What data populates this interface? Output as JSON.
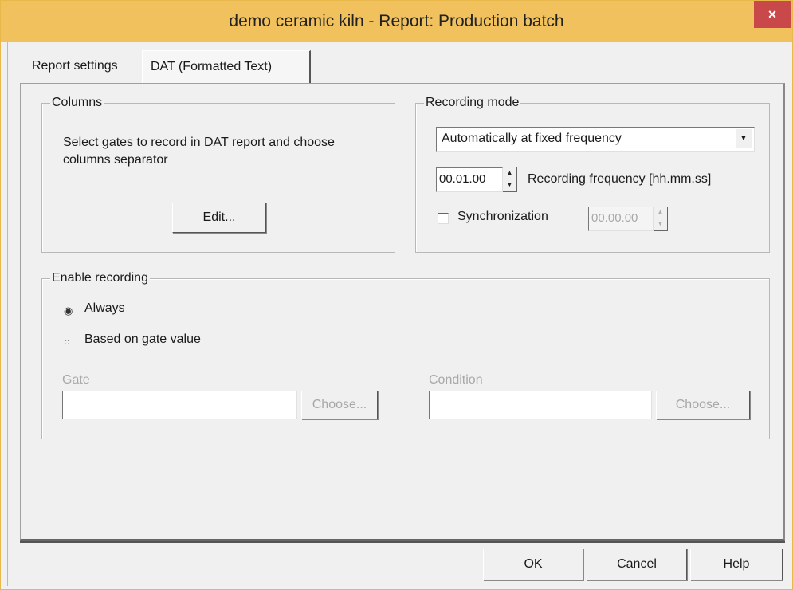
{
  "window": {
    "title": "demo ceramic kiln - Report: Production batch",
    "close_label": "×"
  },
  "tabs": [
    {
      "label": "Report settings",
      "active": false
    },
    {
      "label": "DAT (Formatted Text)",
      "active": true
    }
  ],
  "columns": {
    "legend": "Columns",
    "description": "Select gates to record in DAT report and choose columns separator",
    "edit_label": "Edit..."
  },
  "recording_mode": {
    "legend": "Recording mode",
    "mode_selected": "Automatically at fixed frequency",
    "frequency_value": "00.01.00",
    "frequency_label": "Recording frequency [hh.mm.ss]",
    "sync_label": "Synchronization",
    "sync_checked": false,
    "sync_value": "00.00.00"
  },
  "enable_recording": {
    "legend": "Enable recording",
    "options": [
      "Always",
      "Based on gate value"
    ],
    "selected": "Always",
    "gate_label": "Gate",
    "gate_value": "",
    "gate_choose": "Choose...",
    "condition_label": "Condition",
    "condition_value": "",
    "condition_choose": "Choose..."
  },
  "footer": {
    "ok": "OK",
    "cancel": "Cancel",
    "help": "Help"
  }
}
